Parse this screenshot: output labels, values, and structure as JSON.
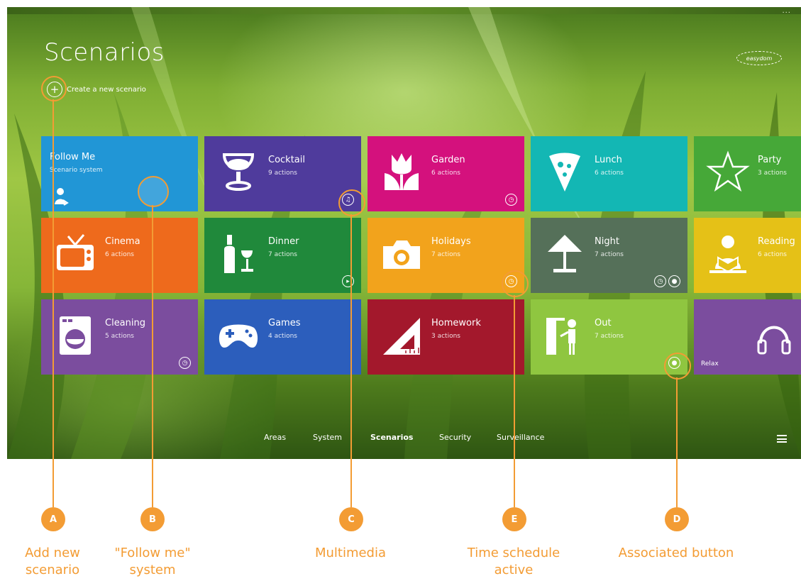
{
  "screen": {
    "title": "Scenarios",
    "create_label": "Create a new scenario",
    "create_icon": "+",
    "logo_text": "easydom",
    "more_dots": "..."
  },
  "tiles": [
    {
      "name": "Follow Me",
      "sub": "Scenario system",
      "color": "#2196d6",
      "icon": "person-icon"
    },
    {
      "name": "Cocktail",
      "sub": "9 actions",
      "color": "#4f3b9c",
      "icon": "glass-icon",
      "badge": "multimedia"
    },
    {
      "name": "Garden",
      "sub": "6 actions",
      "color": "#d4117d",
      "icon": "tulip-icon",
      "badge": "clock"
    },
    {
      "name": "Lunch",
      "sub": "6 actions",
      "color": "#13b7b4",
      "icon": "pizza-icon"
    },
    {
      "name": "Party",
      "sub": "3 actions",
      "color": "#46a838",
      "icon": "star-icon"
    },
    {
      "name": "Cinema",
      "sub": "6 actions",
      "color": "#ee6a1c",
      "icon": "tv-icon"
    },
    {
      "name": "Dinner",
      "sub": "7 actions",
      "color": "#20893b",
      "icon": "bottle-icon",
      "badge": "play"
    },
    {
      "name": "Holidays",
      "sub": "7 actions",
      "color": "#f2a31c",
      "icon": "camera-icon",
      "badge": "clock"
    },
    {
      "name": "Night",
      "sub": "7 actions",
      "color": "#557059",
      "icon": "lamp-icon",
      "badge": "clock+button"
    },
    {
      "name": "Reading",
      "sub": "6 actions",
      "color": "#e5c117",
      "icon": "reader-icon"
    },
    {
      "name": "Cleaning",
      "sub": "5 actions",
      "color": "#7b4d9e",
      "icon": "washer-icon",
      "badge": "clock"
    },
    {
      "name": "Games",
      "sub": "4 actions",
      "color": "#2c5ebc",
      "icon": "gamepad-icon"
    },
    {
      "name": "Homework",
      "sub": "3 actions",
      "color": "#a3182c",
      "icon": "setsquare-icon"
    },
    {
      "name": "Out",
      "sub": "7 actions",
      "color": "#8fc640",
      "icon": "exit-icon",
      "badge": "button"
    },
    {
      "name": "Relax",
      "sub": "",
      "color": "#7b4d9e",
      "icon": "headphones-icon"
    }
  ],
  "nav": [
    "Areas",
    "System",
    "Scenarios",
    "Security",
    "Surveillance"
  ],
  "nav_active": "Scenarios",
  "callouts": [
    {
      "letter": "A",
      "caption": "Add new scenario"
    },
    {
      "letter": "B",
      "caption": "\"Follow me\" system"
    },
    {
      "letter": "C",
      "caption": "Multimedia"
    },
    {
      "letter": "E",
      "caption": "Time schedule active"
    },
    {
      "letter": "D",
      "caption": "Associated button"
    }
  ],
  "accent_color": "#f39c34"
}
